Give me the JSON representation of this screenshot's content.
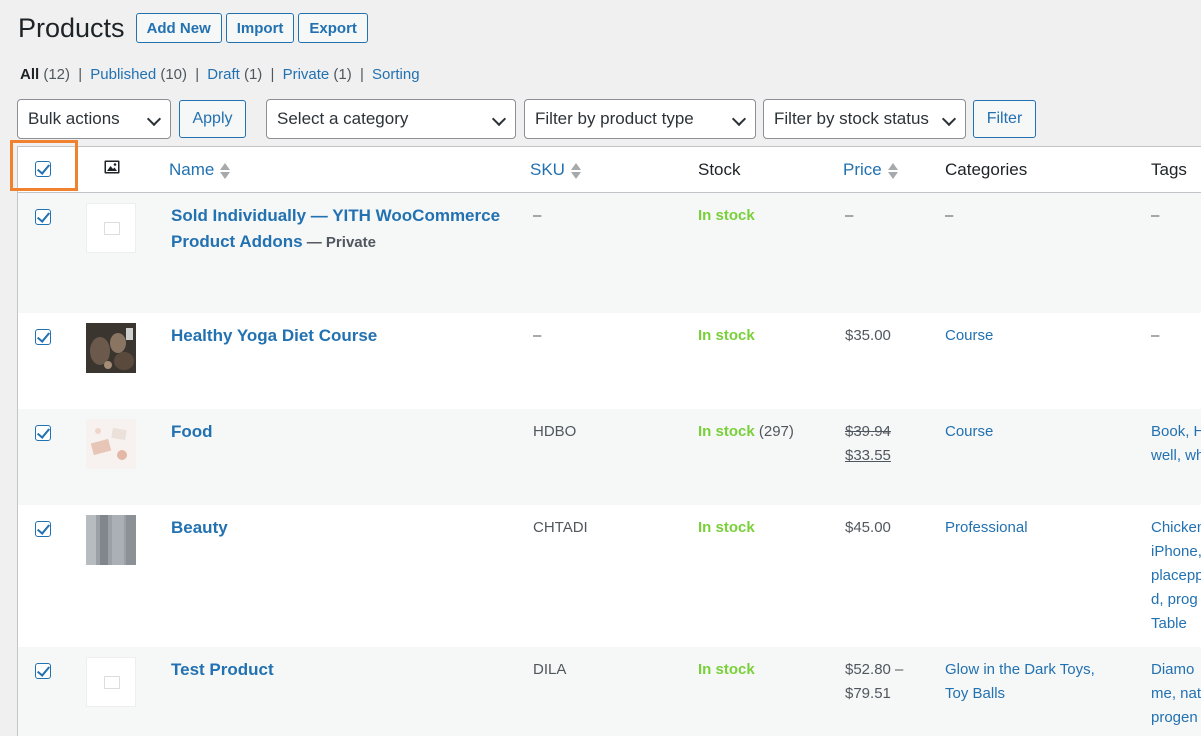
{
  "header": {
    "title": "Products",
    "buttons": [
      "Add New",
      "Import",
      "Export"
    ]
  },
  "views": [
    {
      "label": "All",
      "count": "(12)"
    },
    {
      "label": "Published",
      "count": "(10)"
    },
    {
      "label": "Draft",
      "count": "(1)"
    },
    {
      "label": "Private",
      "count": "(1)"
    },
    {
      "label": "Sorting",
      "count": ""
    }
  ],
  "filters": {
    "bulk_actions": "Bulk actions",
    "apply": "Apply",
    "category": "Select a category",
    "product_type": "Filter by product type",
    "stock_status": "Filter by stock status",
    "filter": "Filter"
  },
  "columns": {
    "name": "Name",
    "sku": "SKU",
    "stock": "Stock",
    "price": "Price",
    "categories": "Categories",
    "tags": "Tags"
  },
  "rows": [
    {
      "name_line1": "Sold Individually — YITH WooCommerce",
      "name_line2": "Product Addons",
      "state": " — Private",
      "sku": "–",
      "stock": "In stock",
      "stock_count": "",
      "price": "–",
      "categories": "–",
      "tags": "–"
    },
    {
      "name_line1": "Healthy Yoga Diet Course",
      "sku": "–",
      "stock": "In stock",
      "stock_count": "",
      "price": "$35.00",
      "categories": "Course",
      "tags": "–"
    },
    {
      "name_line1": "Food",
      "sku": "HDBO",
      "stock": "In stock",
      "stock_count": " (297)",
      "price_regular": "$39.94",
      "price_sale": "$33.55",
      "categories": "Course",
      "tags_line1": "Book, H",
      "tags_line2": "well, wh"
    },
    {
      "name_line1": "Beauty",
      "sku": "CHTADI",
      "stock": "In stock",
      "stock_count": "",
      "price": "$45.00",
      "categories": "Professional",
      "tags_lines": [
        "Chicken",
        "iPhone,",
        "placepp",
        "d, prog",
        "Table"
      ]
    },
    {
      "name_line1": "Test Product",
      "sku": "DILA",
      "stock": "In stock",
      "stock_count": "",
      "price_line1": "$52.80 –",
      "price_line2": "$79.51",
      "categories_line1": "Glow in the Dark Toys,",
      "categories_line2": "Toy Balls",
      "tags_lines": [
        "Diamo",
        "me, nat",
        "progen"
      ]
    }
  ],
  "colors": {
    "link": "#2271b1",
    "in_stock": "#7ad03a",
    "highlight": "#f0822f"
  }
}
